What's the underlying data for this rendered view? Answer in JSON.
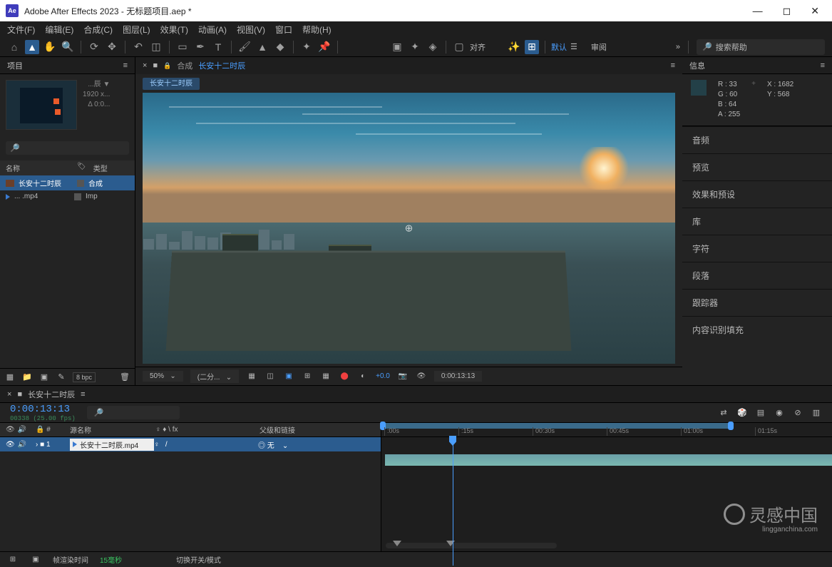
{
  "titlebar": {
    "app": "Adobe After Effects 2023",
    "file": "无标题项目.aep *"
  },
  "menu": [
    "文件(F)",
    "编辑(E)",
    "合成(C)",
    "图层(L)",
    "效果(T)",
    "动画(A)",
    "视图(V)",
    "窗口",
    "帮助(H)"
  ],
  "workspace": {
    "default": "默认",
    "review": "审阅"
  },
  "toolbar": {
    "align": "对齐"
  },
  "search_help": "搜索帮助",
  "project": {
    "title": "项目",
    "meta_name": "...辰 ▼",
    "meta_res": "1920 x...",
    "meta_dur": "Δ 0:0...",
    "col_name": "名称",
    "col_tag": "🏷",
    "col_type": "类型",
    "items": [
      {
        "name": "长安十二时辰",
        "type": "合成"
      },
      {
        "name": "... .mp4",
        "type": "Imp"
      }
    ],
    "bpc": "8 bpc"
  },
  "comp": {
    "label": "合成",
    "name": "长安十二时辰",
    "footer_zoom": "50%",
    "footer_res": "(二分...",
    "footer_exp": "+0.0",
    "footer_tc": "0:00:13:13"
  },
  "info": {
    "title": "信息",
    "R": "R : 33",
    "G": "G : 60",
    "B": "B : 64",
    "A": "A : 255",
    "X": "X : 1682",
    "Y": "Y : 568"
  },
  "side_panels": [
    "音频",
    "预览",
    "效果和预设",
    "库",
    "字符",
    "段落",
    "跟踪器",
    "内容识别填充"
  ],
  "timeline": {
    "name": "长安十二时辰",
    "tc": "0:00:13:13",
    "tc_sub": "00338 (25.00 fps)",
    "ruler": [
      ":00s",
      ":15s",
      "00:30s",
      "00:45s",
      "01:00s",
      "01:15s"
    ],
    "col_source": "源名称",
    "col_parent": "父级和链接",
    "col_sw1": "♀ ♦ \\ fx",
    "col_none": "无",
    "layer_idx": "1",
    "layer_name": "长安十二时辰.mp4",
    "render_label": "帧渲染时间",
    "render_val": "15毫秒",
    "switch_label": "切换开关/模式"
  },
  "watermark": {
    "text": "灵感中国",
    "sub": "lingganchina.com"
  }
}
